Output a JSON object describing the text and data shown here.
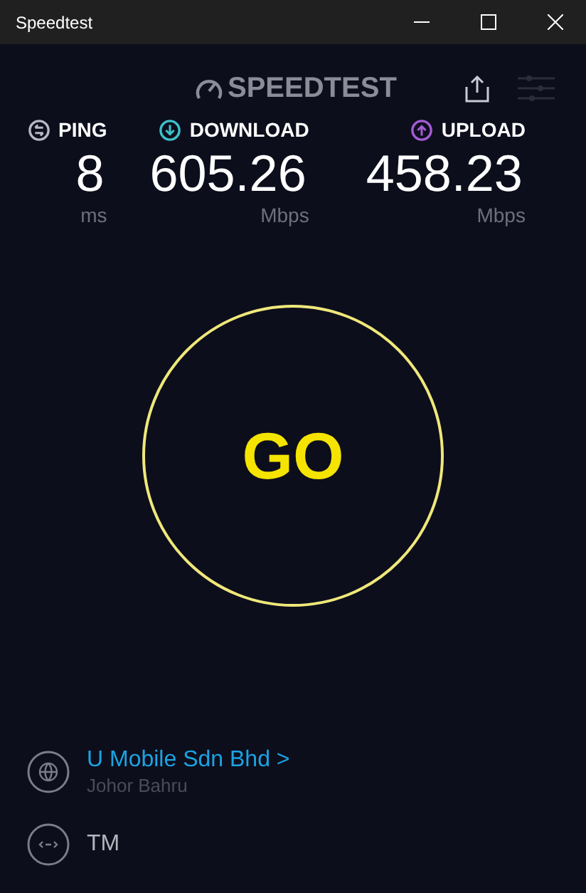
{
  "window": {
    "title": "Speedtest"
  },
  "logo": {
    "text": "SPEEDTEST"
  },
  "metrics": [
    {
      "kind": "ping",
      "label": "PING",
      "value": "8",
      "unit": "ms"
    },
    {
      "kind": "download",
      "label": "DOWNLOAD",
      "value": "605.26",
      "unit": "Mbps"
    },
    {
      "kind": "upload",
      "label": "UPLOAD",
      "value": "458.23",
      "unit": "Mbps"
    }
  ],
  "go_button": {
    "label": "GO"
  },
  "server": {
    "provider": "U Mobile Sdn Bhd",
    "location": "Johor Bahru",
    "chevron": ">"
  },
  "connection": {
    "isp": "TM"
  }
}
